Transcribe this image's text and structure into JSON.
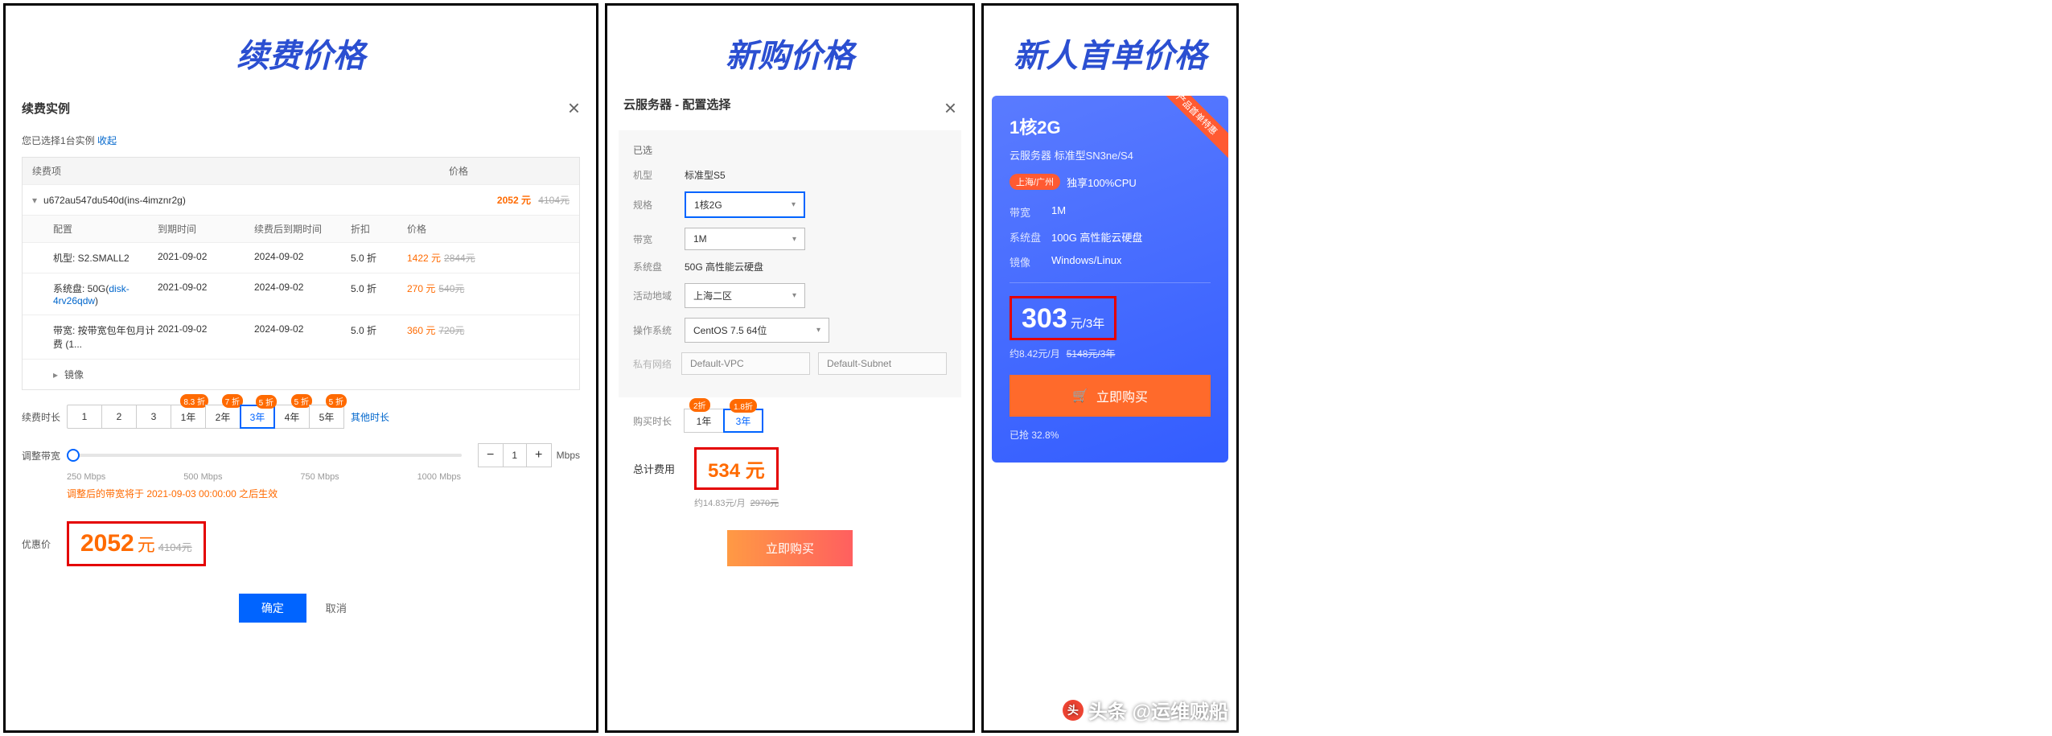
{
  "panel1": {
    "title": "续费价格",
    "section_title": "续费实例",
    "selection_prefix": "您已选择1台实例",
    "selection_link": "收起",
    "head_item": "续费项",
    "head_price": "价格",
    "instance": {
      "name": "u672au547du540d(ins-4imznr2g)",
      "price_now": "2052 元",
      "price_old": "4104元"
    },
    "subhead": {
      "c1": "配置",
      "c2": "到期时间",
      "c3": "续费后到期时间",
      "c4": "折扣",
      "c5": "价格"
    },
    "rows": [
      {
        "cfg": "机型: S2.SMALL2",
        "exp": "2021-09-02",
        "after": "2024-09-02",
        "disc": "5.0 折",
        "pnow": "1422 元",
        "pold": "2844元"
      },
      {
        "cfg_pre": "系统盘: 50G(",
        "cfg_link": "disk-4rv26qdw",
        "cfg_post": ")",
        "exp": "2021-09-02",
        "after": "2024-09-02",
        "disc": "5.0 折",
        "pnow": "270 元",
        "pold": "540元"
      },
      {
        "cfg": "带宽: 按带宽包年包月计费 (1...",
        "exp": "2021-09-02",
        "after": "2024-09-02",
        "disc": "5.0 折",
        "pnow": "360 元",
        "pold": "720元"
      }
    ],
    "image_row": "镜像",
    "dur_label": "续费时长",
    "durations": [
      {
        "t": "1"
      },
      {
        "t": "2"
      },
      {
        "t": "3"
      },
      {
        "t": "1年",
        "tag": "8.3 折"
      },
      {
        "t": "2年",
        "tag": "7 折"
      },
      {
        "t": "3年",
        "tag": "5 折",
        "sel": true
      },
      {
        "t": "4年",
        "tag": "5 折"
      },
      {
        "t": "5年",
        "tag": "5 折"
      }
    ],
    "other_dur": "其他时长",
    "bw_label": "调整带宽",
    "bw_value": "1",
    "bw_unit": "Mbps",
    "ticks": [
      "250 Mbps",
      "500 Mbps",
      "750 Mbps",
      "1000 Mbps"
    ],
    "bw_warn": "调整后的带宽将于 2021-09-03 00:00:00 之后生效",
    "final_label": "优惠价",
    "final_price": "2052",
    "final_unit": "元",
    "final_old": "4104元",
    "btn_ok": "确定",
    "btn_cancel": "取消"
  },
  "panel2": {
    "title": "新购价格",
    "section_title": "云服务器 - 配置选择",
    "already": "已选",
    "model_lab": "机型",
    "model_val": "标准型S5",
    "spec_lab": "规格",
    "spec_val": "1核2G",
    "bw_lab": "带宽",
    "bw_val": "1M",
    "disk_lab": "系统盘",
    "disk_val": "50G 高性能云硬盘",
    "region_lab": "活动地域",
    "region_val": "上海二区",
    "os_lab": "操作系统",
    "os_val": "CentOS 7.5 64位",
    "net_lab": "私有网络",
    "net_v1": "Default-VPC",
    "net_v2": "Default-Subnet",
    "dur_lab": "购买时长",
    "dur_opts": [
      {
        "t": "1年",
        "tag": "2折"
      },
      {
        "t": "3年",
        "tag": "1.8折",
        "sel": true
      }
    ],
    "cost_lab": "总计费用",
    "cost_val": "534 元",
    "cost_sub": "约14.83元/月",
    "cost_old": "2970元",
    "buy": "立即购买"
  },
  "panel3": {
    "title": "新人首单价格",
    "ribbon": "产品首单特惠",
    "h1": "1核2G",
    "sub": "云服务器 标准型SN3ne/S4",
    "loc_pill": "上海/广州",
    "loc_txt": "独享100%CPU",
    "specs": [
      {
        "k": "带宽",
        "v": "1M"
      },
      {
        "k": "系统盘",
        "v": "100G 高性能云硬盘"
      },
      {
        "k": "镜像",
        "v": "Windows/Linux"
      }
    ],
    "price_n": "303",
    "price_u": "元/3年",
    "per": "约8.42元/月",
    "per_old": "5148元/3年",
    "buy": "立即购买",
    "grab": "已抢 32.8%",
    "watermark": "头条 @运维贼船"
  }
}
